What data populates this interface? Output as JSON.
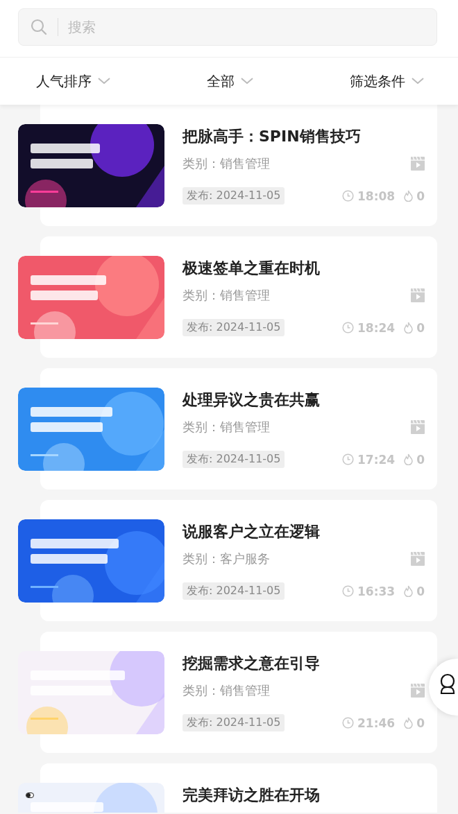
{
  "search": {
    "placeholder": "搜索"
  },
  "filters": [
    {
      "label": "人气排序"
    },
    {
      "label": "全部"
    },
    {
      "label": "筛选条件"
    }
  ],
  "courses": [
    {
      "title": "把脉高手：SPIN销售技巧",
      "category": "类别：销售管理",
      "date": "发布: 2024-11-05",
      "duration": "18:08",
      "views": "0"
    },
    {
      "title": "极速签单之重在时机",
      "category": "类别：销售管理",
      "date": "发布: 2024-11-05",
      "duration": "18:24",
      "views": "0"
    },
    {
      "title": "处理异议之贵在共赢",
      "category": "类别：销售管理",
      "date": "发布: 2024-11-05",
      "duration": "17:24",
      "views": "0"
    },
    {
      "title": "说服客户之立在逻辑",
      "category": "类别：客户服务",
      "date": "发布: 2024-11-05",
      "duration": "16:33",
      "views": "0"
    },
    {
      "title": "挖掘需求之意在引导",
      "category": "类别：销售管理",
      "date": "发布: 2024-11-05",
      "duration": "21:46",
      "views": "0"
    },
    {
      "title": "完美拜访之胜在开场"
    }
  ]
}
